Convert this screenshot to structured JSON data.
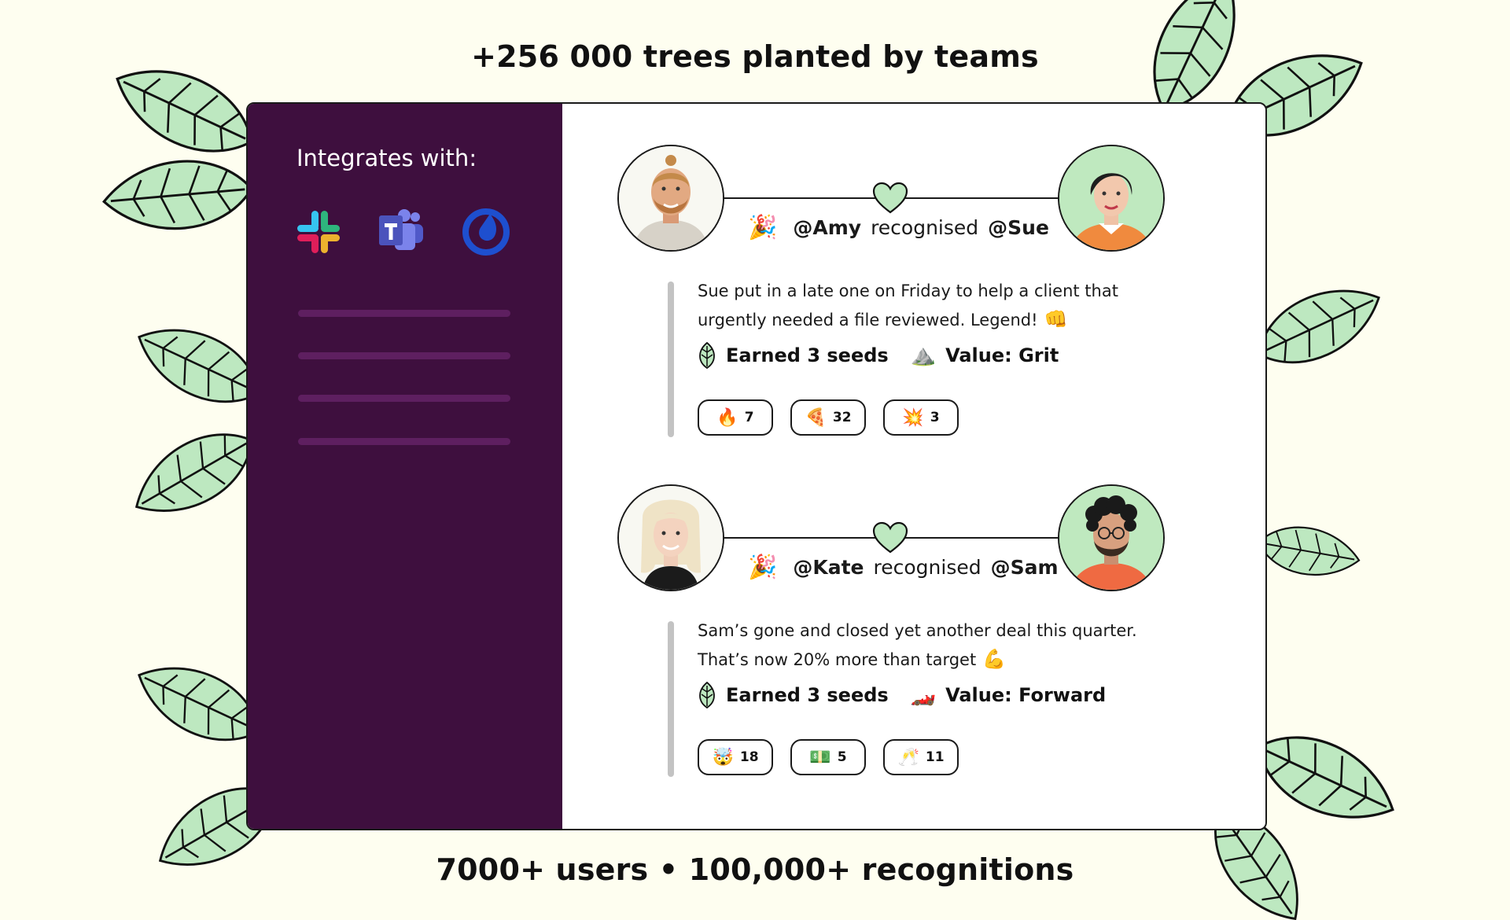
{
  "headline_top": "+256 000 trees planted by teams",
  "headline_bottom": "7000+ users • 100,000+ recognitions",
  "sidebar": {
    "title": "Integrates with:",
    "integrations": [
      "Slack",
      "Microsoft Teams",
      "Mattermost"
    ]
  },
  "posts": [
    {
      "from": "@Amy",
      "verb": "recognised",
      "to": "@Sue",
      "message_line1": "Sue put in a late one on Friday to help a client that",
      "message_line2": "urgently needed a file reviewed. Legend!",
      "message_emoji": "👊",
      "seeds": "Earned 3 seeds",
      "value_emoji": "⛰️",
      "value": "Value: Grit",
      "reactions": [
        {
          "emoji": "🔥",
          "count": "7"
        },
        {
          "emoji": "🍕",
          "count": "32"
        },
        {
          "emoji": "💥",
          "count": "3"
        }
      ]
    },
    {
      "from": "@Kate",
      "verb": "recognised",
      "to": "@Sam",
      "message_line1": "Sam’s gone and closed yet another deal this quarter.",
      "message_line2": "That’s now 20% more than target",
      "message_emoji": "💪",
      "seeds": "Earned 3 seeds",
      "value_emoji": "🏎️",
      "value": "Value: Forward",
      "reactions": [
        {
          "emoji": "🤯",
          "count": "18"
        },
        {
          "emoji": "💵",
          "count": "5"
        },
        {
          "emoji": "🥂",
          "count": "11"
        }
      ]
    }
  ],
  "party_emoji": "🎉",
  "colors": {
    "background": "#fefef0",
    "sidebar": "#3e0f3e",
    "sidebar_line": "#5e1f60",
    "leaf": "#bde8c0",
    "heart": "#bde8c0",
    "avatar_bg_green": "#bfe9bf"
  }
}
